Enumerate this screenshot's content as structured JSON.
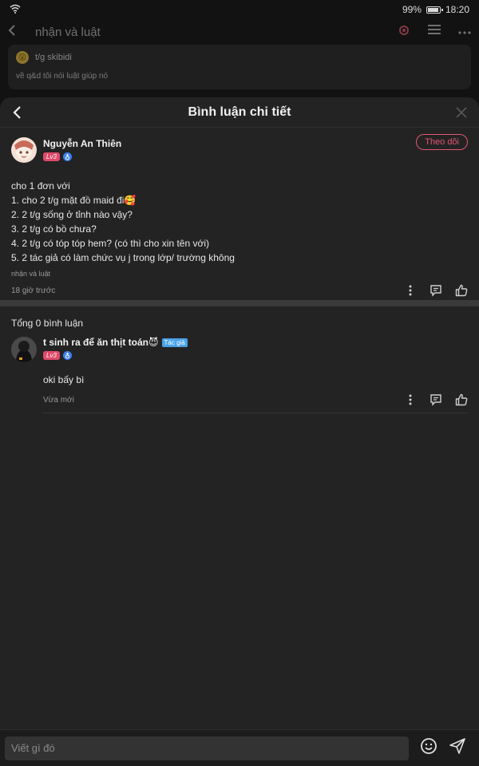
{
  "status_bar": {
    "battery": "99%",
    "time": "18:20",
    "battery_level": 0.99
  },
  "background_page": {
    "title": "nhận và luật",
    "card": {
      "author": "t/g skibidi",
      "text": "về q&d tôi nói luật giúp nó"
    }
  },
  "sheet": {
    "title": "Bình luận chi tiết"
  },
  "main_comment": {
    "author": "Nguyễn An Thiên",
    "level": "Lv3",
    "follow_label": "Theo dõi",
    "lines": [
      "cho 1 đơn với",
      "1. cho 2 t/g mặt đồ maid đi🥰",
      "2. 2 t/g sống ở tỉnh nào vậy?",
      "3. 2 t/g có bồ chưa?",
      "4. 2 t/g có tóp tóp hem? (có thì cho xin tên với)",
      "5. 2 tác giả có làm chức vụ j trong lớp/ trường không"
    ],
    "source": "nhận và luật",
    "time": "18 giờ trước"
  },
  "replies": {
    "total_label": "Tổng 0 bình luận",
    "items": [
      {
        "author": "t sinh ra để ăn thịt toán😈",
        "author_tag": "Tác giả",
        "level": "Lv3",
        "text": "oki bấy bì",
        "time": "Vừa mới"
      }
    ]
  },
  "input": {
    "placeholder": "Viết gì đó"
  },
  "colors": {
    "accent": "#e25672",
    "author_tag": "#4aa3e8",
    "background": "#232323"
  },
  "icons": [
    "wifi-icon",
    "battery-icon",
    "back-icon",
    "gear-icon",
    "list-icon",
    "more-icon",
    "close-icon",
    "more-vertical-icon",
    "reply-icon",
    "like-icon",
    "emoji-icon",
    "send-icon",
    "male-icon"
  ]
}
